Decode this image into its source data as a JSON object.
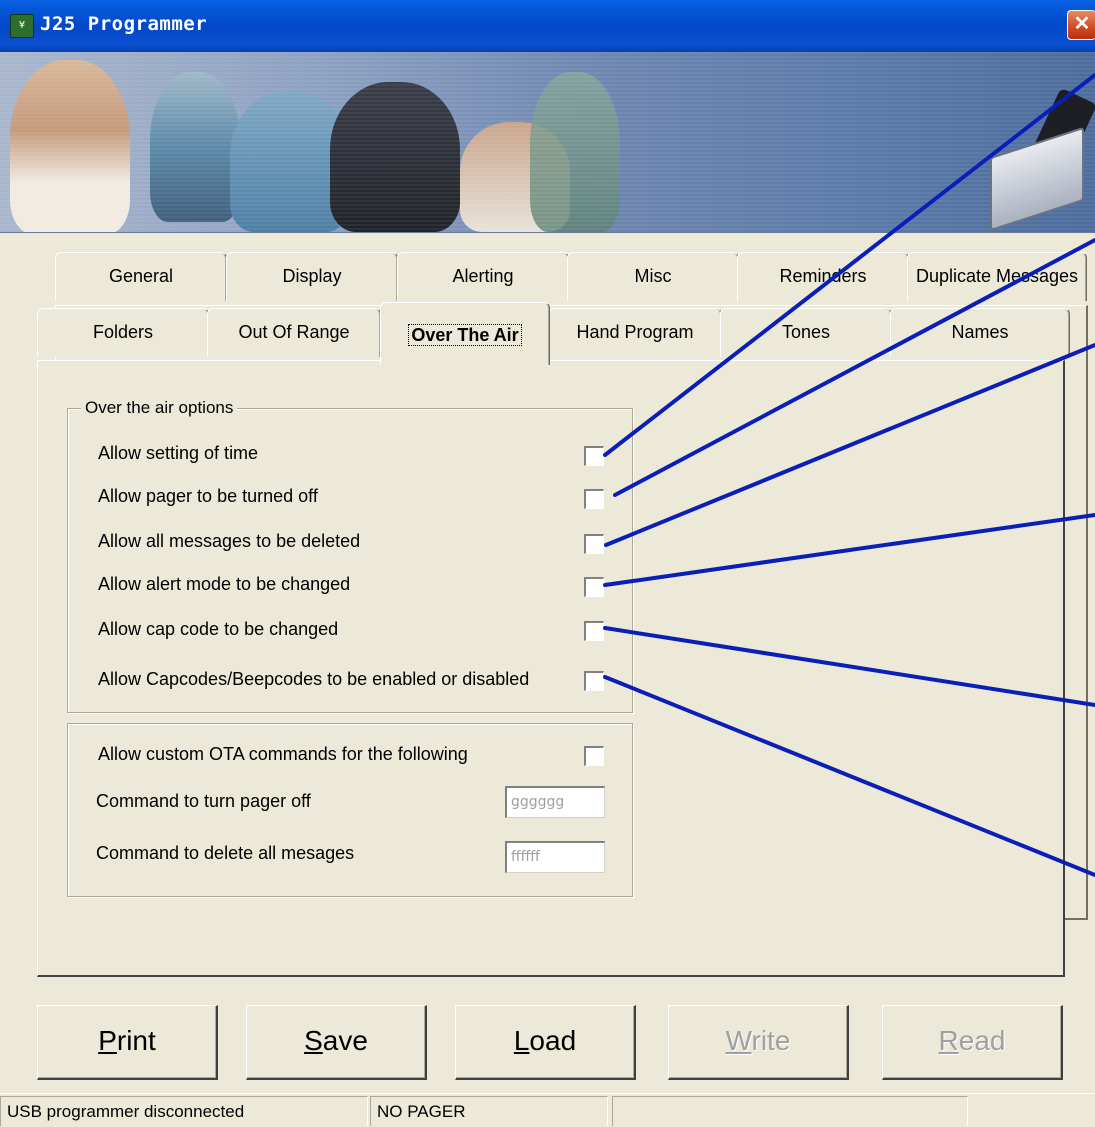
{
  "window": {
    "title": "J25 Programmer",
    "icon_text": "¥"
  },
  "tabs_back": [
    {
      "label": "General"
    },
    {
      "label": "Display"
    },
    {
      "label": "Alerting"
    },
    {
      "label": "Misc"
    },
    {
      "label": "Reminders"
    },
    {
      "label": "Duplicate Messages"
    }
  ],
  "tabs_front": [
    {
      "label": "Folders"
    },
    {
      "label": "Out Of Range"
    },
    {
      "label": "Over The Air"
    },
    {
      "label": "Hand Program"
    },
    {
      "label": "Tones"
    },
    {
      "label": "Names"
    }
  ],
  "active_tab": "Over The Air",
  "ota_group": {
    "legend": "Over the air options",
    "options": [
      {
        "label": "Allow setting of time",
        "checked": false
      },
      {
        "label": "Allow pager to be turned off",
        "checked": false
      },
      {
        "label": "Allow all messages to be deleted",
        "checked": false
      },
      {
        "label": "Allow alert mode to be changed",
        "checked": false
      },
      {
        "label": "Allow cap code to be changed",
        "checked": false
      },
      {
        "label": "Allow Capcodes/Beepcodes to be enabled or disabled",
        "checked": false
      }
    ]
  },
  "custom_group": {
    "custom_label": "Allow custom OTA commands for the following",
    "custom_checked": false,
    "pager_off_label": "Command to turn pager off",
    "pager_off_value": "gggggg",
    "delete_label": "Command to delete all mesages",
    "delete_value": "ffffff"
  },
  "buttons": {
    "print": {
      "pre": "",
      "key": "P",
      "post": "rint"
    },
    "save": {
      "pre": "",
      "key": "S",
      "post": "ave"
    },
    "load": {
      "pre": "",
      "key": "L",
      "post": "oad"
    },
    "write": {
      "pre": "",
      "key": "W",
      "post": "rite"
    },
    "read": {
      "pre": "",
      "key": "R",
      "post": "ead"
    }
  },
  "status": {
    "connection": "USB programmer disconnected",
    "pager": "NO PAGER",
    "extra": ""
  },
  "annotation_color": "#0a1fb8",
  "close_icon": "✕"
}
